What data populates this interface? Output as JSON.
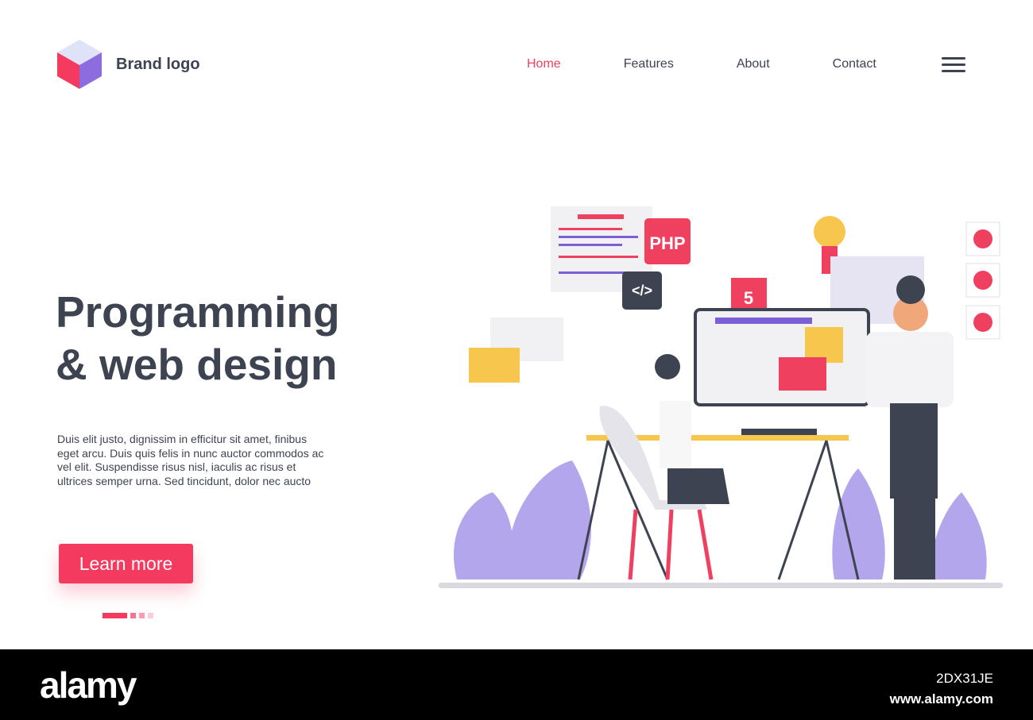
{
  "header": {
    "brand": "Brand logo",
    "nav": [
      {
        "label": "Home",
        "active": true
      },
      {
        "label": "Features"
      },
      {
        "label": "About"
      },
      {
        "label": "Contact"
      }
    ],
    "menu_icon": "hamburger-icon"
  },
  "hero": {
    "title_line1": "Programming",
    "title_line2": "& web design",
    "description": "Duis elit justo, dignissim in efficitur sit amet, finibus eget arcu. Duis quis felis in nunc auctor commodos ac vel elit. Suspendisse risus nisl, iaculis ac risus et ultrices semper urna. Sed tincidunt, dolor nec aucto",
    "cta": "Learn more",
    "pager": {
      "pages": 4,
      "active": 1
    }
  },
  "illustration": {
    "php_label": "PHP",
    "code_label": "</>",
    "html5_label": "5"
  },
  "colors": {
    "accent": "#f43a5f",
    "purple": "#8c6cdf",
    "text": "#3d4350"
  },
  "footer": {
    "brand": "alamy",
    "image_id": "2DX31JE",
    "site": "www.alamy.com"
  }
}
